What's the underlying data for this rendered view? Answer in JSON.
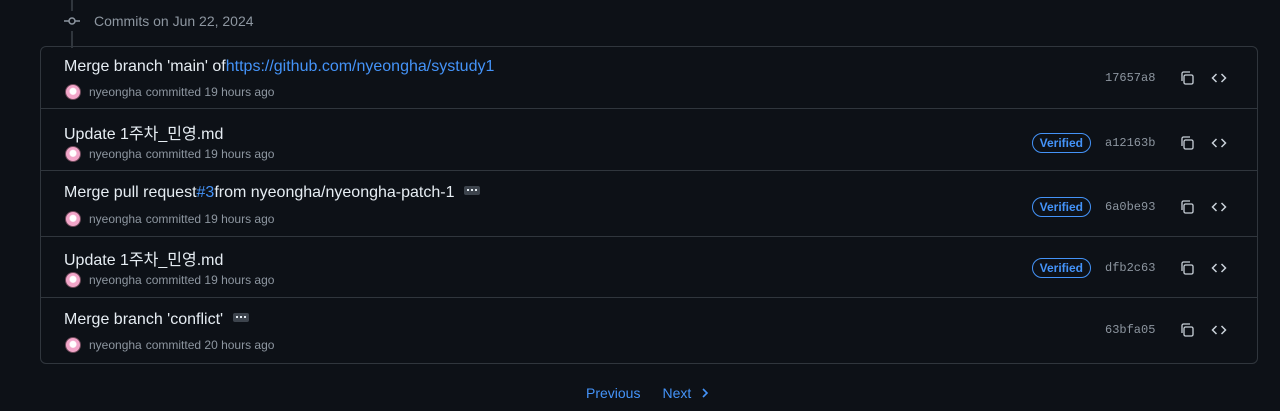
{
  "group": {
    "title": "Commits on Jun 22, 2024"
  },
  "commits": [
    {
      "title_prefix": "Merge branch 'main' of ",
      "title_link": "https://github.com/nyeongha/systudy1",
      "title_suffix": "",
      "has_ellipsis": false,
      "author": "nyeongha",
      "action": "committed 19 hours ago",
      "verified": "",
      "sha": "17657a8"
    },
    {
      "title_prefix": "Update 1주차_민영.md",
      "title_link": "",
      "title_suffix": "",
      "has_ellipsis": false,
      "author": "nyeongha",
      "action": "committed 19 hours ago",
      "verified": "Verified",
      "sha": "a12163b"
    },
    {
      "title_prefix": "Merge pull request ",
      "title_link": "#3",
      "title_suffix": " from nyeongha/nyeongha-patch-1",
      "has_ellipsis": true,
      "author": "nyeongha",
      "action": "committed 19 hours ago",
      "verified": "Verified",
      "sha": "6a0be93"
    },
    {
      "title_prefix": "Update 1주차_민영.md",
      "title_link": "",
      "title_suffix": "",
      "has_ellipsis": false,
      "author": "nyeongha",
      "action": "committed 19 hours ago",
      "verified": "Verified",
      "sha": "dfb2c63"
    },
    {
      "title_prefix": "Merge branch 'conflict'",
      "title_link": "",
      "title_suffix": "",
      "has_ellipsis": true,
      "author": "nyeongha",
      "action": "committed 20 hours ago",
      "verified": "",
      "sha": "63bfa05"
    }
  ],
  "pagination": {
    "previous_label": "Previous",
    "next_label": "Next"
  },
  "colors": {
    "background": "#0d1117",
    "border": "#30363d",
    "link": "#4493f8",
    "muted": "#8d96a0",
    "text": "#e6edf3"
  },
  "icons": {
    "group": "git-commit-icon",
    "copy": "copy-icon",
    "browse": "code-icon",
    "next": "chevron-right-icon"
  }
}
